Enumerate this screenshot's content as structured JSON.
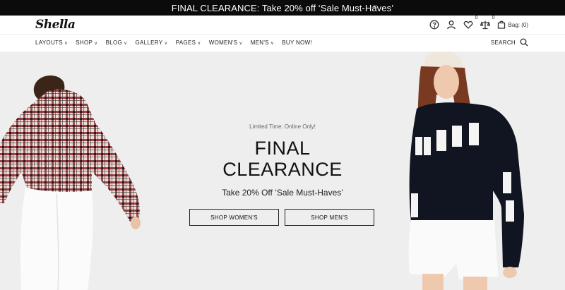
{
  "announcement": {
    "text": "FINAL CLEARANCE: Take 20% off ‘Sale Must-Haves’",
    "close": "×"
  },
  "header": {
    "logo": "Shella",
    "icons": {
      "help": "help-icon",
      "account": "user-icon",
      "wishlist": "heart-icon",
      "compare": "compare-icon",
      "bag": "bag-icon"
    },
    "wishlist_count": "0",
    "compare_count": "0",
    "bag_label": "Bag: (0)"
  },
  "nav": {
    "items": [
      {
        "label": "LAYOUTS",
        "chevron": "∨"
      },
      {
        "label": "SHOP",
        "chevron": "∨"
      },
      {
        "label": "BLOG",
        "chevron": "∨"
      },
      {
        "label": "GALLERY",
        "chevron": "∨"
      },
      {
        "label": "PAGES",
        "chevron": "∨"
      },
      {
        "label": "WOMEN'S",
        "chevron": "∨"
      },
      {
        "label": "MEN'S",
        "chevron": "∨"
      },
      {
        "label": "BUY NOW!",
        "chevron": ""
      }
    ],
    "search_label": "SEARCH"
  },
  "hero": {
    "kicker": "Limited Time: Online Only!",
    "headline_line1": "FINAL",
    "headline_line2": "CLEARANCE",
    "subheadline": "Take 20% Off ‘Sale Must-Haves’",
    "button_women": "SHOP WOMEN'S",
    "button_men": "SHOP MEN'S",
    "sweater_text": "FOOL FOR YOU",
    "colors": {
      "background": "#eeeeee",
      "sweater": "#111522",
      "plaid_red": "#8e2430",
      "hair": "#7a3a22"
    }
  }
}
